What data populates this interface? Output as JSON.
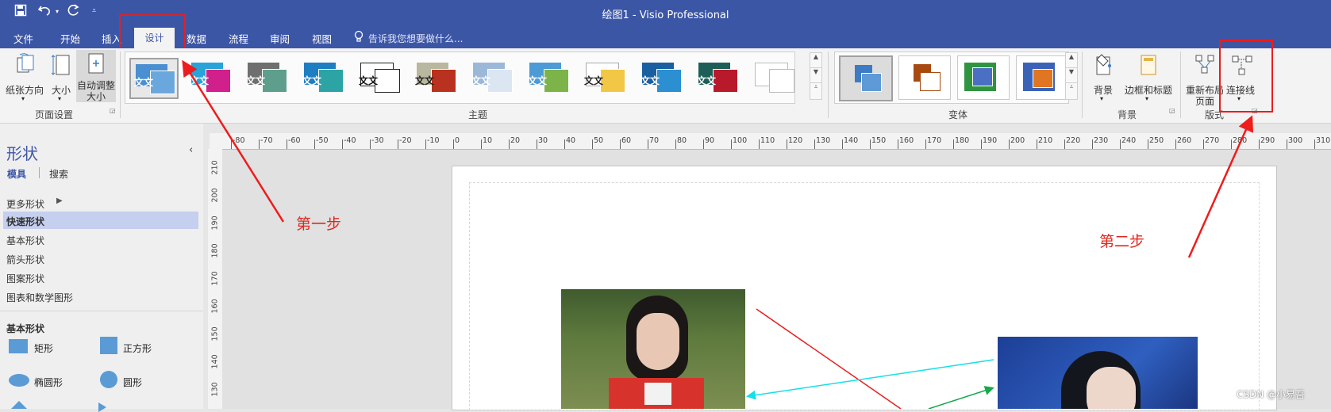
{
  "title_bar": {
    "title": "绘图1 - Visio Professional",
    "qat": [
      "save-icon",
      "undo-icon",
      "redo-icon",
      "customize-icon"
    ]
  },
  "tabs": [
    "文件",
    "开始",
    "插入",
    "设计",
    "数据",
    "流程",
    "审阅",
    "视图"
  ],
  "tell_me": "告诉我您想要做什么...",
  "page_setup": {
    "buttons": [
      "纸张方向",
      "大小",
      "自动调整大小"
    ],
    "auto_fit_lines": [
      "自动调整",
      "大小"
    ],
    "group": "页面设置"
  },
  "themes": {
    "thumb_text": "文文",
    "group": "主题"
  },
  "variants": {
    "group": "变体"
  },
  "backgrounds": {
    "buttons": [
      "背景",
      "边框和标题"
    ],
    "group": "背景"
  },
  "layout": {
    "relayout_lines": [
      "重新布局",
      "页面"
    ],
    "connector": "连接线",
    "group": "版式"
  },
  "shapes_pane": {
    "title": "形状",
    "tabs": [
      "模具",
      "搜索"
    ],
    "stencils": [
      "更多形状",
      "快速形状",
      "基本形状",
      "箭头形状",
      "图案形状",
      "图表和数学图形"
    ],
    "section": "基本形状",
    "shapes": [
      "矩形",
      "正方形",
      "椭圆形",
      "圆形"
    ]
  },
  "ruler_h": [
    "-80",
    "-70",
    "-60",
    "-50",
    "-40",
    "-30",
    "-20",
    "-10",
    "0",
    "10",
    "20",
    "30",
    "40",
    "50",
    "60",
    "70",
    "80",
    "90",
    "100",
    "110",
    "120",
    "130",
    "140",
    "150",
    "160",
    "170",
    "180",
    "190",
    "200",
    "210",
    "220",
    "230",
    "240",
    "250",
    "260",
    "270",
    "280",
    "290",
    "300",
    "310"
  ],
  "ruler_v": [
    "210",
    "200",
    "190",
    "180",
    "170",
    "160",
    "150",
    "140",
    "130"
  ],
  "annotations": {
    "step1": "第一步",
    "step2": "第二步"
  },
  "watermark": "CSDN @小易吾",
  "colors": {
    "brand": "#3c56a6",
    "annotation": "#ee1c1c"
  }
}
